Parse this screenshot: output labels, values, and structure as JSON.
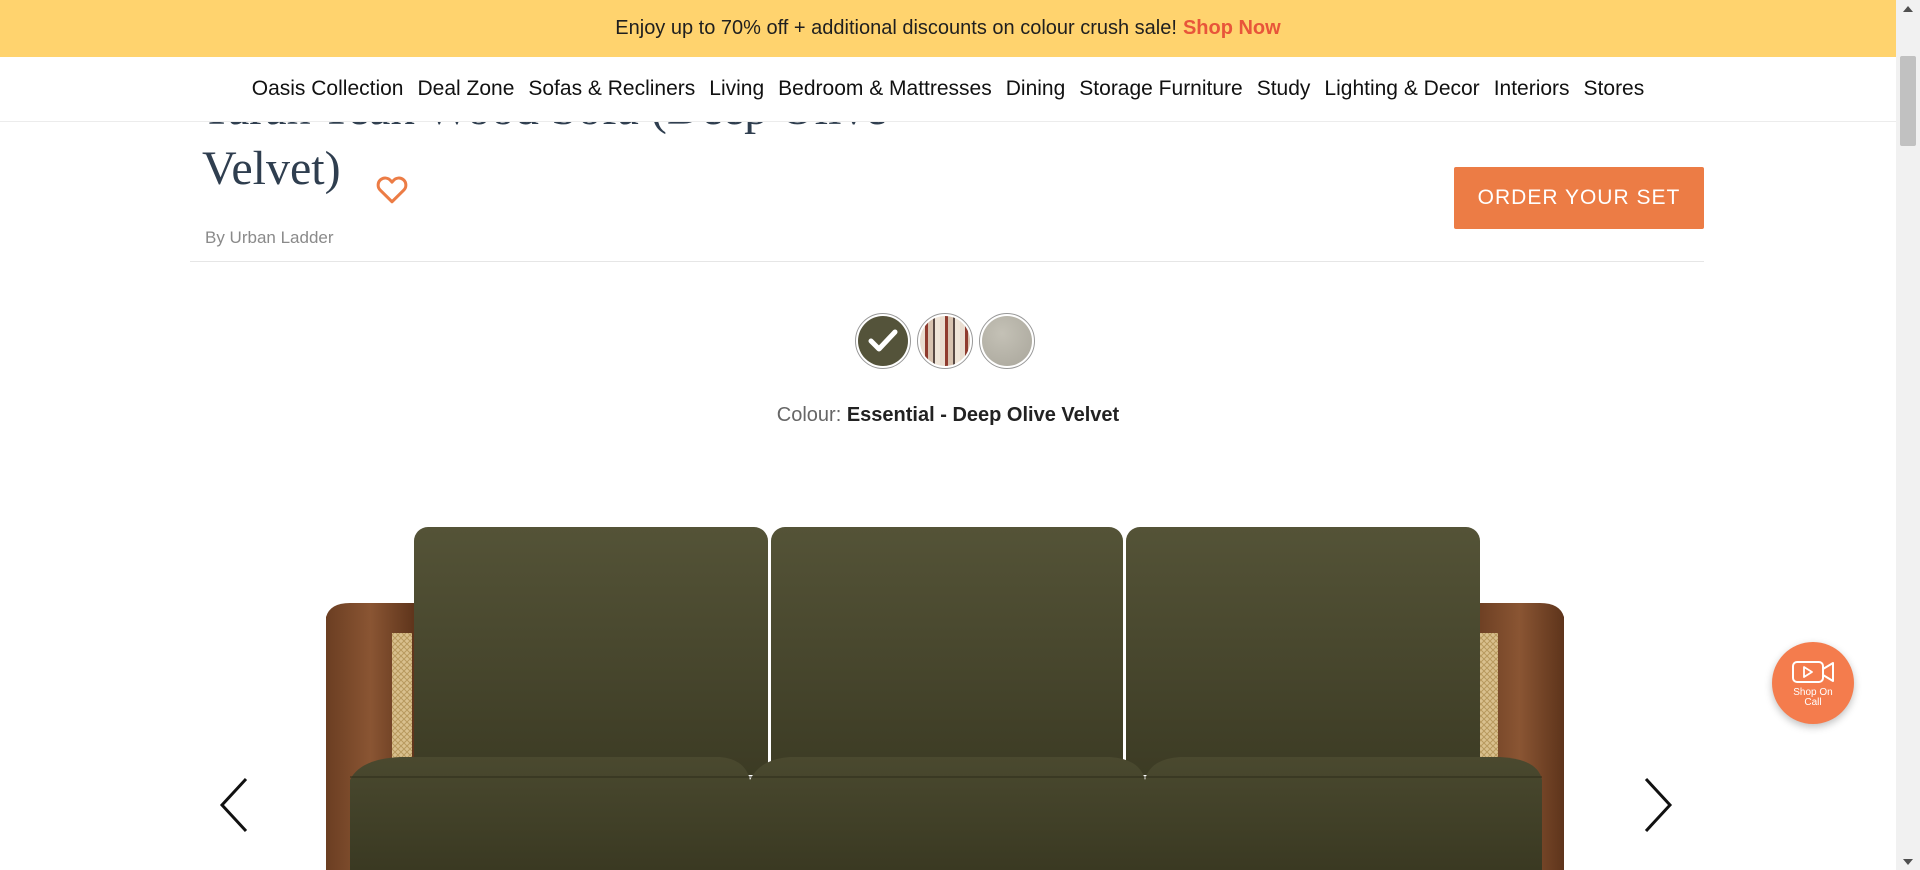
{
  "promo": {
    "text": "Enjoy up to 70% off + additional discounts on colour crush sale!",
    "cta": "Shop Now"
  },
  "nav": {
    "items": [
      "Oasis Collection",
      "Deal Zone",
      "Sofas & Recliners",
      "Living",
      "Bedroom & Mattresses",
      "Dining",
      "Storage Furniture",
      "Study",
      "Lighting & Decor",
      "Interiors",
      "Stores"
    ]
  },
  "product": {
    "title": "Taran Teak Wood Sofa (Deep Olive Velvet)",
    "brand": "By Urban Ladder",
    "order_button": "ORDER YOUR SET",
    "colour_label": "Colour:",
    "colour_value": "Essential - Deep Olive Velvet",
    "swatches": [
      {
        "name": "Deep Olive Velvet",
        "color": "#54533a",
        "selected": true
      },
      {
        "name": "Patterned Ikat",
        "color": "#c9a893",
        "selected": false
      },
      {
        "name": "Grey",
        "color": "#b3b0a5",
        "selected": false
      }
    ]
  },
  "shop_on_call": {
    "label": "Shop On Call"
  },
  "colors": {
    "promo_bg": "#ffd36e",
    "accent": "#ec7c45",
    "sale_red": "#e8553a",
    "title": "#2f3e4f"
  }
}
